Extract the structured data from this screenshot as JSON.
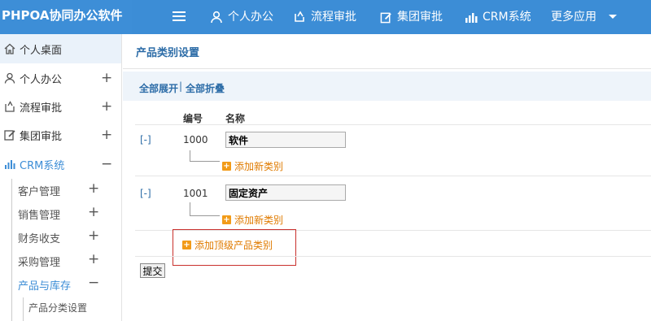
{
  "app": {
    "brand": "PHPOA协同办公软件"
  },
  "topnav": [
    {
      "label": "个人办公",
      "icon": "user-icon"
    },
    {
      "label": "流程审批",
      "icon": "flow-icon"
    },
    {
      "label": "集团审批",
      "icon": "edit-icon"
    },
    {
      "label": "CRM系统",
      "icon": "bar-chart-icon"
    },
    {
      "label": "更多应用",
      "icon": "caret-down-icon"
    }
  ],
  "sidebar": {
    "items": [
      {
        "label": "个人桌面",
        "icon": "home-icon",
        "toggle": ""
      },
      {
        "label": "个人办公",
        "icon": "user-icon",
        "toggle": "+"
      },
      {
        "label": "流程审批",
        "icon": "flow-icon",
        "toggle": "+"
      },
      {
        "label": "集团审批",
        "icon": "edit-icon",
        "toggle": "+"
      },
      {
        "label": "CRM系统",
        "icon": "bar-chart-icon",
        "toggle": "−"
      }
    ],
    "sub_items": [
      {
        "label": "客户管理",
        "toggle": "+"
      },
      {
        "label": "销售管理",
        "toggle": "+"
      },
      {
        "label": "财务收支",
        "toggle": "+"
      },
      {
        "label": "采购管理",
        "toggle": "+"
      },
      {
        "label": "产品与库存",
        "toggle": "−"
      }
    ],
    "leaf_items": [
      {
        "label": "产品分类设置"
      }
    ]
  },
  "main": {
    "title": "产品类别设置",
    "expand_all": "全部展开",
    "separator": "|",
    "collapse_all": "全部折叠",
    "columns": {
      "code": "编号",
      "name": "名称"
    },
    "categories": [
      {
        "toggle": "[-]",
        "code": "1000",
        "name": "软件",
        "add_child": "添加新类别"
      },
      {
        "toggle": "[-]",
        "code": "1001",
        "name": "固定资产",
        "add_child": "添加新类别"
      }
    ],
    "add_top": "添加顶级产品类别",
    "submit": "提交"
  },
  "colors": {
    "accent": "#3c8dd6",
    "link": "#2c6ca7",
    "add": "#e07b00",
    "highlight": "#c9302c"
  }
}
